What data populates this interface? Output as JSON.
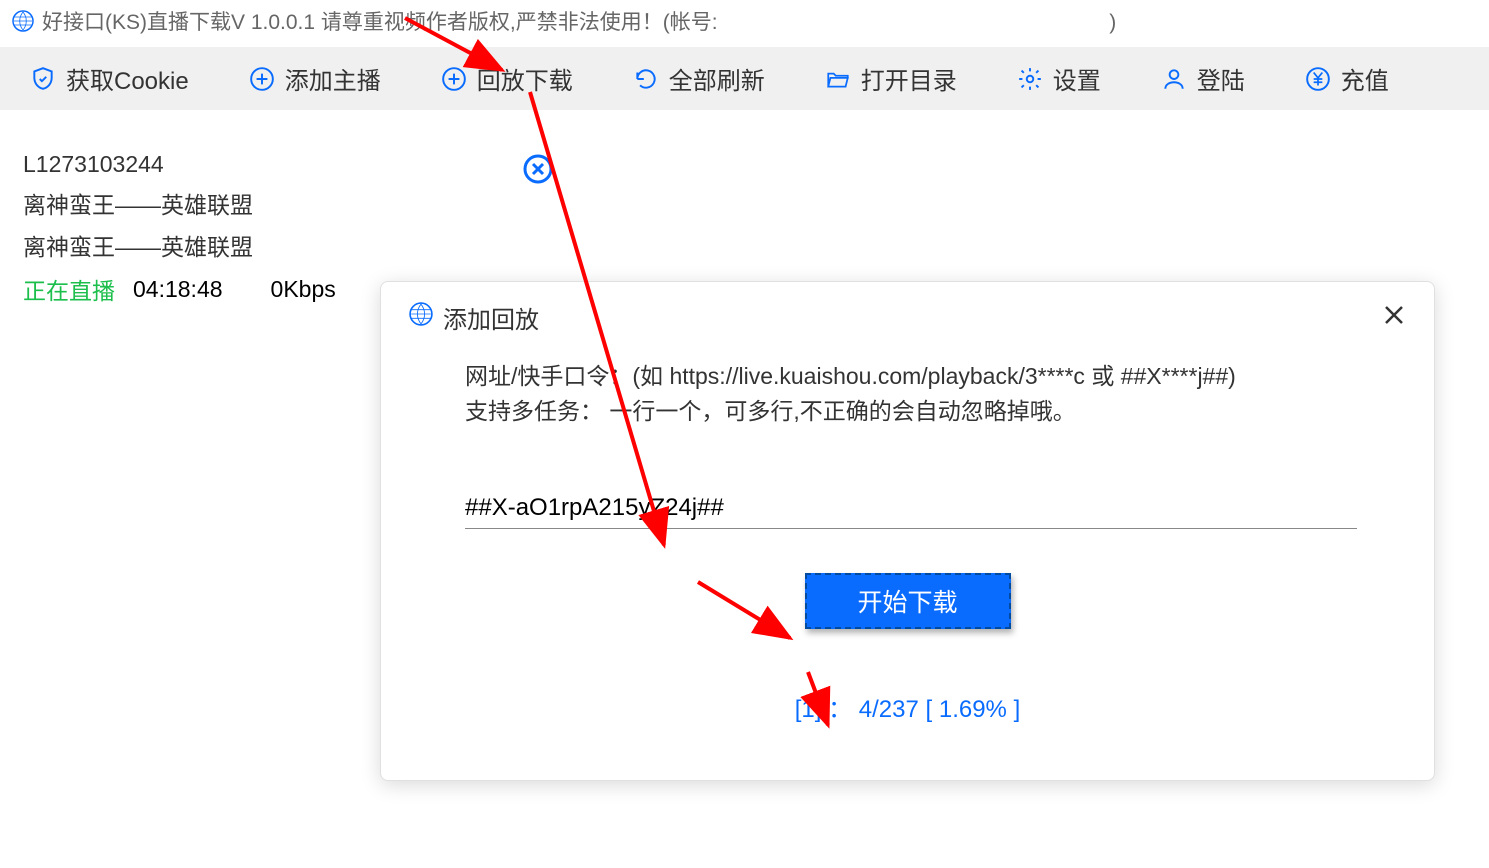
{
  "titlebar": {
    "text": "好接口(KS)直播下载V 1.0.0.1 请尊重视频作者版权,严禁非法使用！(帐号:",
    "text_tail": ")"
  },
  "toolbar": {
    "get_cookie": "获取Cookie",
    "add_host": "添加主播",
    "playback_download": "回放下载",
    "refresh_all": "全部刷新",
    "open_dir": "打开目录",
    "settings": "设置",
    "login": "登陆",
    "recharge": "充值"
  },
  "card": {
    "id": "L1273103244",
    "line2": "离神蛮王——英雄联盟",
    "line3": "离神蛮王——英雄联盟",
    "status": "正在直播",
    "time": "04:18:48",
    "speed": "0Kbps"
  },
  "dialog": {
    "title": "添加回放",
    "hint1": "网址/快手口令：(如 https://live.kuaishou.com/playback/3****c 或 ##X****j##)",
    "hint2": "支持多任务：  一行一个，可多行,不正确的会自动忽略掉哦。",
    "input_value": "##X-aO1rpA215yZ24j##",
    "start_btn": "开始下载",
    "progress": "[1] ： 4/237 [ 1.69% ]"
  }
}
